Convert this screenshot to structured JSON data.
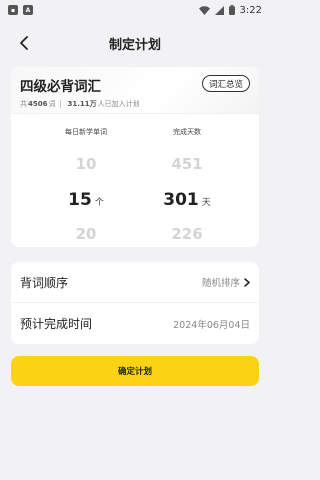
{
  "status": {
    "time": "3:22",
    "notif_icon_1": "app-notification-icon",
    "notif_icon_2": "a-icon"
  },
  "nav": {
    "title": "制定计划",
    "back_icon": "chevron-left-icon"
  },
  "book": {
    "title": "四级必背词汇",
    "total_prefix": "共",
    "total_words": "4506",
    "total_suffix": "词",
    "joined_count": "31.11万",
    "joined_suffix": "人已加入计划",
    "vocab_button": "词汇总览"
  },
  "picker": {
    "daily_label": "每日新学单词",
    "days_label": "完成天数",
    "daily_options": [
      "10",
      "15",
      "20"
    ],
    "daily_selected_index": 1,
    "daily_unit": "个",
    "days_options": [
      "451",
      "301",
      "226"
    ],
    "days_selected_index": 1,
    "days_unit": "天"
  },
  "settings": {
    "order_label": "背词顺序",
    "order_value": "随机排序",
    "finish_label": "预计完成时间",
    "finish_value": "2024年06月04日"
  },
  "confirm_label": "确定计划",
  "colors": {
    "accent": "#fcd314",
    "background": "#f2f2f4",
    "card": "#ffffff"
  }
}
